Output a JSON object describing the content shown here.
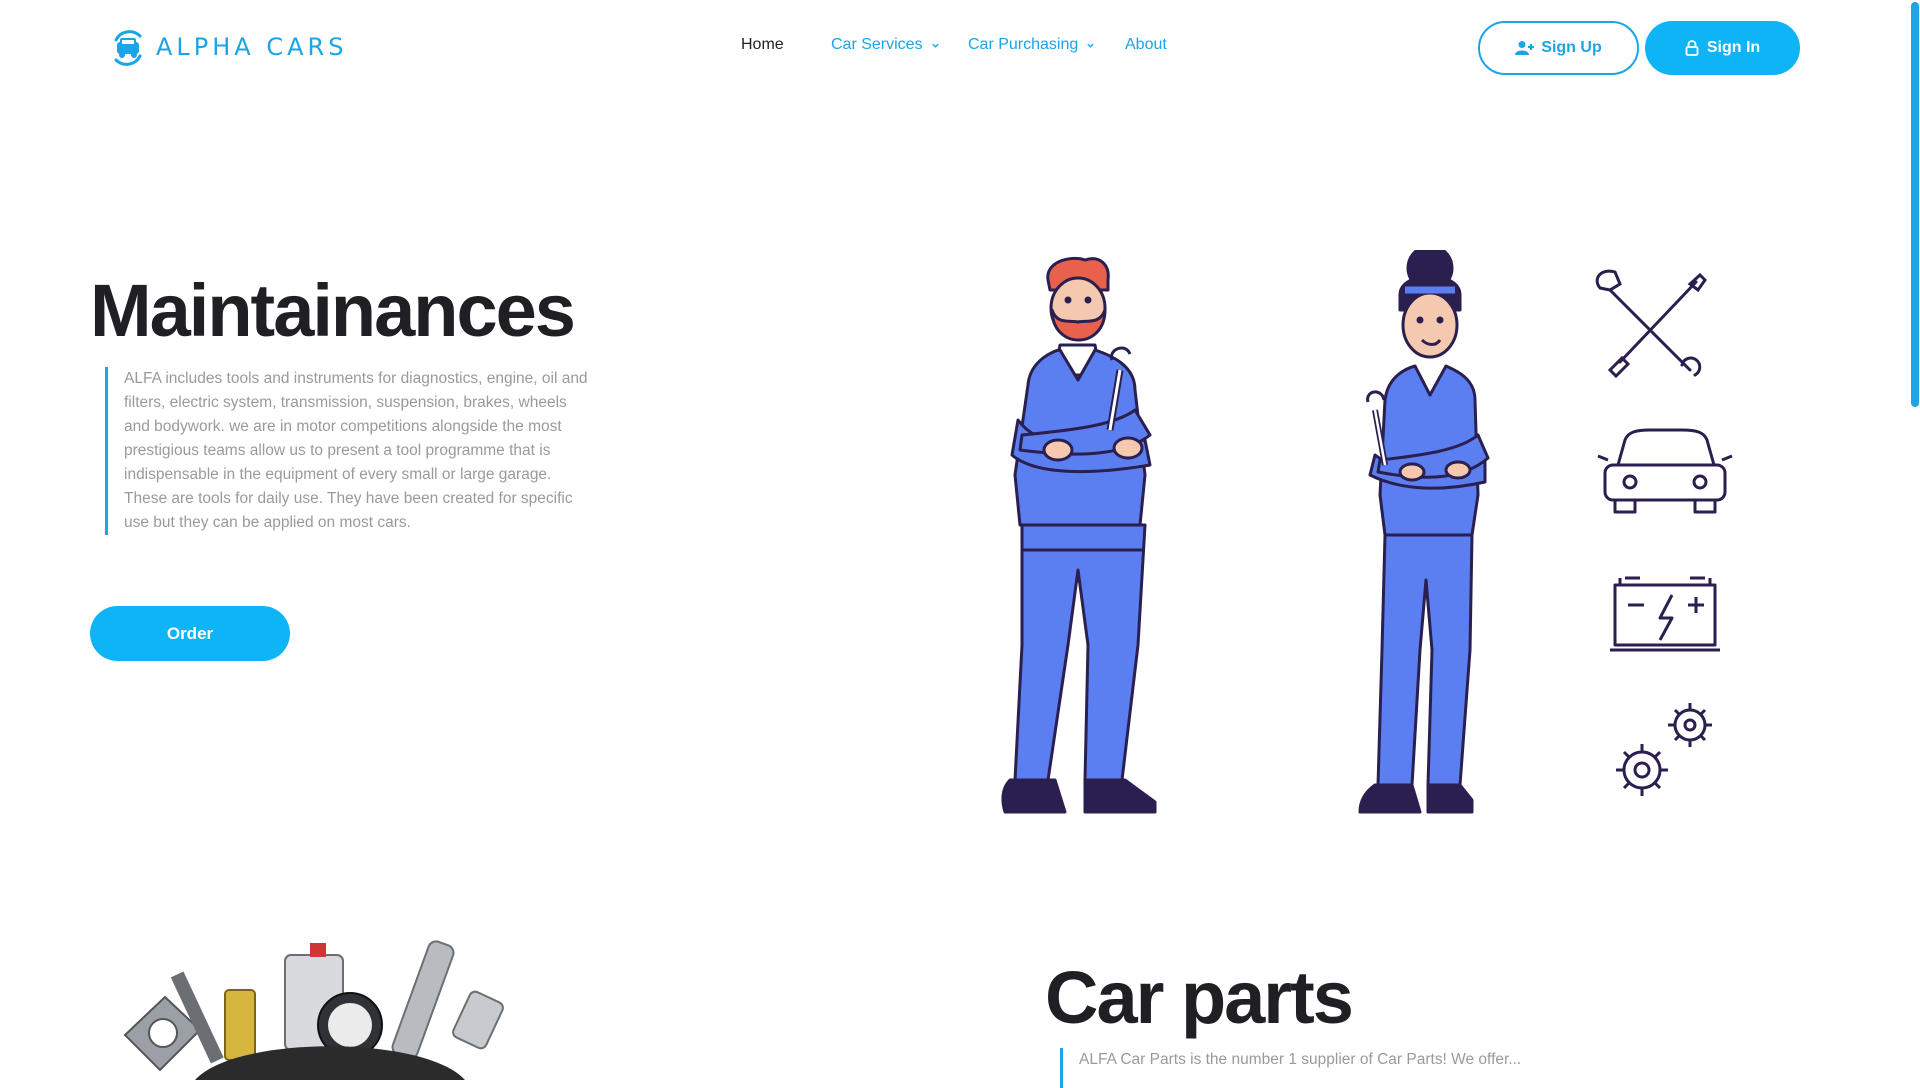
{
  "brand": {
    "name": "ALPHA CARS",
    "color": "#1ba4e6"
  },
  "nav": {
    "items": [
      {
        "label": "Home",
        "dropdown": false,
        "active": true
      },
      {
        "label": "Car Services",
        "dropdown": true,
        "active": false
      },
      {
        "label": "Car Purchasing",
        "dropdown": true,
        "active": false
      },
      {
        "label": "About",
        "dropdown": false,
        "active": false
      }
    ]
  },
  "auth": {
    "signup_label": "Sign Up",
    "signup_icon": "user-plus-icon",
    "signin_label": "Sign In",
    "signin_icon": "lock-icon"
  },
  "hero": {
    "title": "Maintainances",
    "description": "ALFA includes tools and instruments for diagnostics, engine, oil and filters, electric system, transmission, suspension, brakes, wheels and bodywork. we are in motor competitions alongside the most prestigious teams allow us to present a tool programme that is indispensable in the equipment of every small or large garage. These are tools for daily use. They have been created for specific use but they can be applied on most cars.",
    "order_label": "Order",
    "side_icons": [
      "wrench-screwdriver-icon",
      "car-icon",
      "battery-icon",
      "gears-icon"
    ]
  },
  "parts": {
    "title": "Car parts",
    "description": "ALFA Car Parts is the number 1 supplier of Car Parts! We offer..."
  },
  "colors": {
    "accent": "#0eb4f5",
    "accent_text": "#1ba4e6",
    "worker_uniform": "#5b7ff0",
    "outline": "#2a1f4f"
  }
}
